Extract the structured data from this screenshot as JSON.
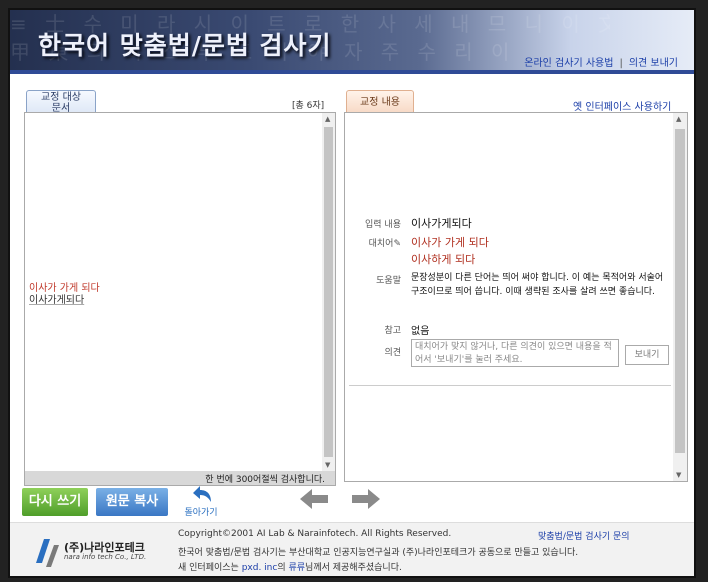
{
  "header": {
    "title": "한국어 맞춤법/문법 검사기",
    "links": [
      "온라인 검사기 사용법",
      "의견 보내기"
    ]
  },
  "left": {
    "tab_label": "교정 대상 문서",
    "char_count": "[총 6자]",
    "corrected_text": "이사가 가게 되다",
    "original_text": "이사가게되다",
    "status": "한 번에 300어절씩 검사합니다."
  },
  "right": {
    "tab_label": "교정 내용",
    "old_ui_link": "옛 인터페이스 사용하기",
    "input_label": "입력 내용",
    "input_value": "이사가게되다",
    "suggest_label": "대치어",
    "suggestions": [
      "이사가 가게 되다",
      "이사하게 되다"
    ],
    "help_label": "도움말",
    "help_text": "문장성분이 다른 단어는 띄어 써야 합니다. 이 예는 목적어와 서술어 구조이므로 띄어 씁니다. 이때 생략된 조사를 살려 쓰면 좋습니다.",
    "ref_label": "참고",
    "ref_value": "없음",
    "opinion_label": "의견",
    "opinion_placeholder": "대치어가 맞지 않거나, 다른 의견이 있으면 내용을 적어서 '보내기'를 눌러 주세요.",
    "send_label": "보내기"
  },
  "actions": {
    "rewrite": "다시 쓰기",
    "copy": "원문 복사",
    "back": "돌아가기"
  },
  "footer": {
    "company_ko": "(주)나라인포테크",
    "company_en": "nara info tech Co., LTD.",
    "copyright": "Copyright©2001 AI Lab & Narainfotech. All Rights Reserved.",
    "inquiry": "맞춤법/문법 검사기 문의",
    "line2": "한국어 맞춤법/문법 검사기는 부산대학교 인공지능연구실과 (주)나라인포테크가 공동으로 만들고 있습니다.",
    "line3_pre": "새 인터페이스는 ",
    "line3_link1": "pxd. inc",
    "line3_mid": "의 ",
    "line3_link2": "류류",
    "line3_post": "님께서 제공해주셨습니다."
  },
  "colors": {
    "accent_blue": "#1b3ea8",
    "red": "#b03020",
    "green": "#4f9e2a"
  }
}
